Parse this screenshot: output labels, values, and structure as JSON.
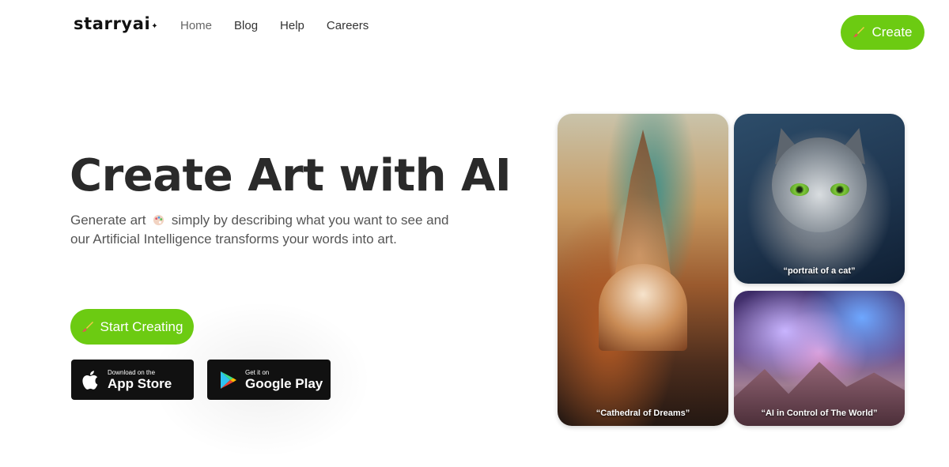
{
  "header": {
    "logo_text": "starryai",
    "nav": [
      {
        "label": "Home"
      },
      {
        "label": "Blog"
      },
      {
        "label": "Help"
      },
      {
        "label": "Careers"
      }
    ],
    "create_label": "Create"
  },
  "hero": {
    "title": "Create Art with AI",
    "subtitle_part1": "Generate art",
    "subtitle_part2": "simply by describing what you want to see and our Artificial Intelligence transforms your words into art.",
    "start_label": "Start Creating",
    "app_store": {
      "small": "Download on the",
      "big": "App Store"
    },
    "google_play": {
      "small": "Get it on",
      "big": "Google Play"
    }
  },
  "gallery": [
    {
      "caption": "“Cathedral of Dreams”"
    },
    {
      "caption": "“portrait of a cat”"
    },
    {
      "caption": "“AI in Control of The World”"
    }
  ],
  "colors": {
    "accent": "#6ccb12",
    "store_bg": "#111111"
  },
  "icons": [
    "brush-icon",
    "palette-icon",
    "apple-icon",
    "google-play-icon",
    "sparkle-icon"
  ]
}
